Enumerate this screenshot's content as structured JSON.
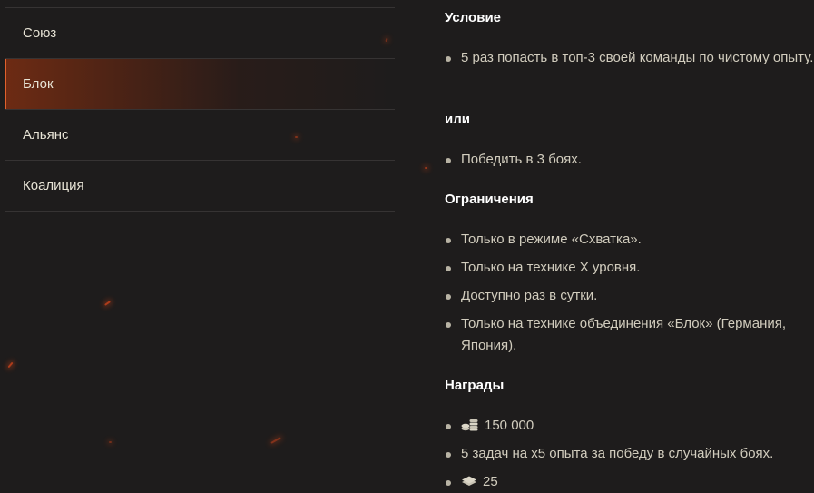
{
  "sidebar": {
    "tabs": [
      {
        "label": "Союз"
      },
      {
        "label": "Блок",
        "active": true
      },
      {
        "label": "Альянс"
      },
      {
        "label": "Коалиция"
      }
    ]
  },
  "content": {
    "condition": {
      "heading": "Условие",
      "items": [
        "5 раз попасть в топ-3 своей команды по чистому опыту."
      ]
    },
    "or": {
      "heading": "или",
      "items": [
        "Победить в 3 боях."
      ]
    },
    "limits": {
      "heading": "Ограничения",
      "items": [
        "Только в режиме «Схватка».",
        "Только на технике X уровня.",
        "Доступно раз в сутки.",
        "Только на технике объединения «Блок» (Германия, Япония)."
      ]
    },
    "rewards": {
      "heading": "Награды",
      "items": [
        {
          "icon": "credits-icon",
          "text": "150 000"
        },
        {
          "text": "5 задач на x5 опыта за победу в случайных боях."
        },
        {
          "icon": "bonds-icon",
          "text": "25"
        }
      ]
    }
  },
  "colors": {
    "background": "#1e1c1c",
    "accent": "#e0602d",
    "heading": "#ffffff",
    "text": "#d2cdbe"
  }
}
